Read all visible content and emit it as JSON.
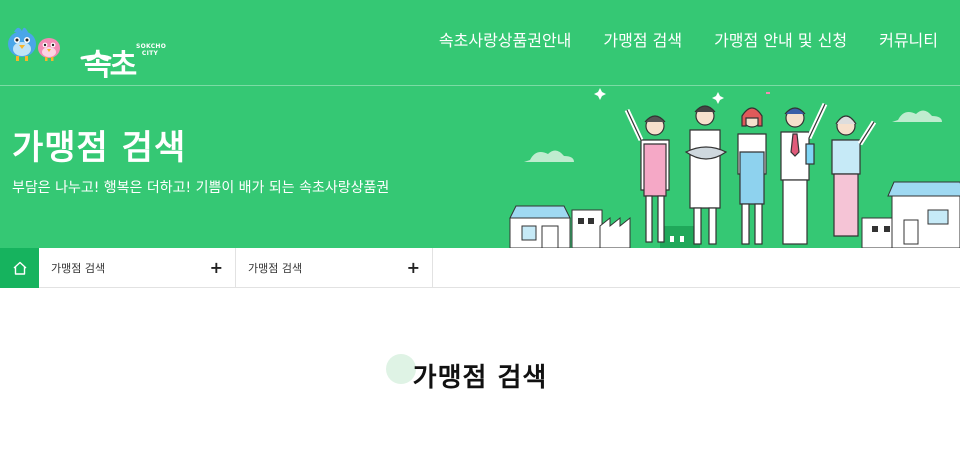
{
  "header": {
    "logo": {
      "text": "속초",
      "sub_line1": "SOKCHO",
      "sub_line2": "CITY"
    },
    "nav": [
      {
        "label": "속초사랑상품권안내"
      },
      {
        "label": "가맹점 검색"
      },
      {
        "label": "가맹점 안내 및 신청"
      },
      {
        "label": "커뮤니티"
      }
    ]
  },
  "hero": {
    "title": "가맹점 검색",
    "subtitle": "부담은 나누고! 행복은 더하고! 기쁨이 배가 되는 속초사랑상품권"
  },
  "breadcrumb": {
    "home_icon": "home-icon",
    "items": [
      {
        "label": "가맹점 검색",
        "icon": "plus-icon"
      },
      {
        "label": "가맹점 검색",
        "icon": "plus-icon"
      }
    ]
  },
  "main": {
    "title": "가맹점 검색"
  },
  "colors": {
    "brand_green": "#35c874",
    "home_green": "#16b35e"
  }
}
